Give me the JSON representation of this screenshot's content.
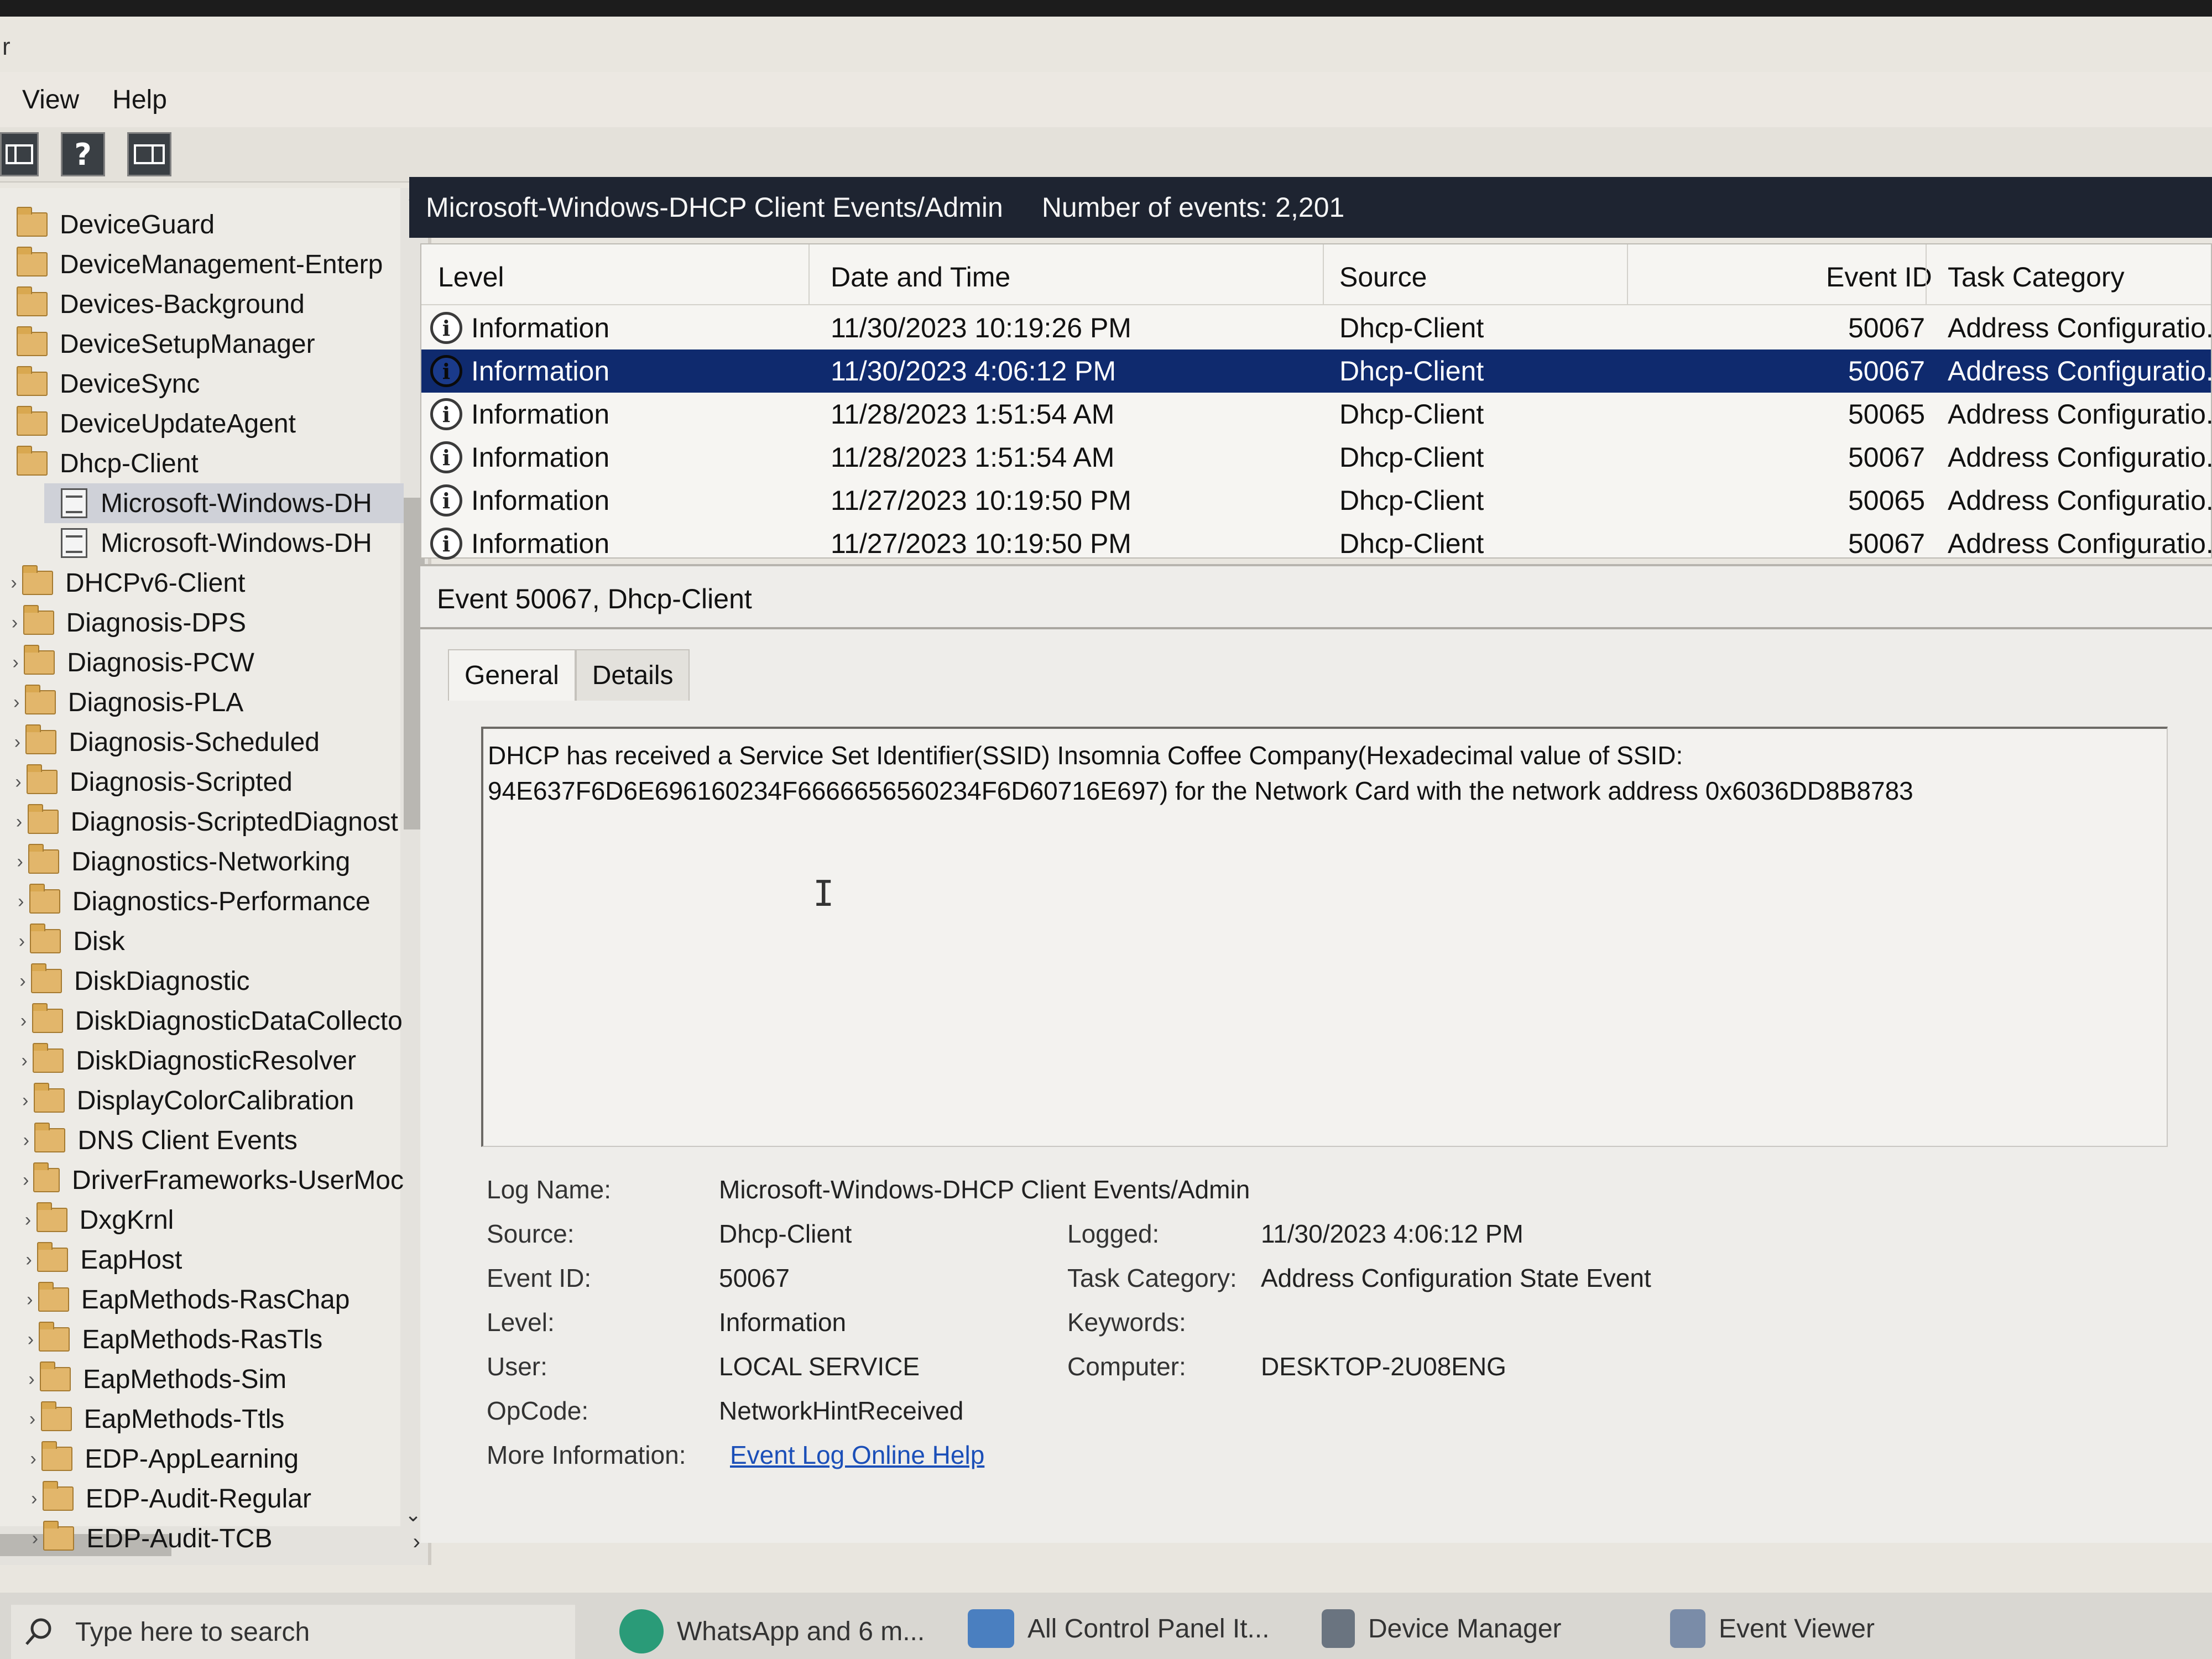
{
  "window": {
    "title_glyph": "r"
  },
  "menu": {
    "items": [
      "View",
      "Help"
    ]
  },
  "toolbar": {
    "help_glyph": "?"
  },
  "tree": {
    "items": [
      {
        "label": "DeviceGuard",
        "type": "folder",
        "selected": false
      },
      {
        "label": "DeviceManagement-Enterp",
        "type": "folder",
        "selected": false
      },
      {
        "label": "Devices-Background",
        "type": "folder",
        "selected": false
      },
      {
        "label": "DeviceSetupManager",
        "type": "folder",
        "selected": false
      },
      {
        "label": "DeviceSync",
        "type": "folder",
        "selected": false
      },
      {
        "label": "DeviceUpdateAgent",
        "type": "folder",
        "selected": false
      },
      {
        "label": "Dhcp-Client",
        "type": "folder",
        "selected": false
      },
      {
        "label": "Microsoft-Windows-DH",
        "type": "log",
        "selected": true
      },
      {
        "label": "Microsoft-Windows-DH",
        "type": "log",
        "selected": false
      },
      {
        "label": "DHCPv6-Client",
        "type": "folder",
        "selected": false
      },
      {
        "label": "Diagnosis-DPS",
        "type": "folder",
        "selected": false
      },
      {
        "label": "Diagnosis-PCW",
        "type": "folder",
        "selected": false
      },
      {
        "label": "Diagnosis-PLA",
        "type": "folder",
        "selected": false
      },
      {
        "label": "Diagnosis-Scheduled",
        "type": "folder",
        "selected": false
      },
      {
        "label": "Diagnosis-Scripted",
        "type": "folder",
        "selected": false
      },
      {
        "label": "Diagnosis-ScriptedDiagnost",
        "type": "folder",
        "selected": false
      },
      {
        "label": "Diagnostics-Networking",
        "type": "folder",
        "selected": false
      },
      {
        "label": "Diagnostics-Performance",
        "type": "folder",
        "selected": false
      },
      {
        "label": "Disk",
        "type": "folder",
        "selected": false
      },
      {
        "label": "DiskDiagnostic",
        "type": "folder",
        "selected": false
      },
      {
        "label": "DiskDiagnosticDataCollecto",
        "type": "folder",
        "selected": false
      },
      {
        "label": "DiskDiagnosticResolver",
        "type": "folder",
        "selected": false
      },
      {
        "label": "DisplayColorCalibration",
        "type": "folder",
        "selected": false
      },
      {
        "label": "DNS Client Events",
        "type": "folder",
        "selected": false
      },
      {
        "label": "DriverFrameworks-UserMoc",
        "type": "folder",
        "selected": false
      },
      {
        "label": "DxgKrnl",
        "type": "folder",
        "selected": false
      },
      {
        "label": "EapHost",
        "type": "folder",
        "selected": false
      },
      {
        "label": "EapMethods-RasChap",
        "type": "folder",
        "selected": false
      },
      {
        "label": "EapMethods-RasTls",
        "type": "folder",
        "selected": false
      },
      {
        "label": "EapMethods-Sim",
        "type": "folder",
        "selected": false
      },
      {
        "label": "EapMethods-Ttls",
        "type": "folder",
        "selected": false
      },
      {
        "label": "EDP-AppLearning",
        "type": "folder",
        "selected": false
      },
      {
        "label": "EDP-Audit-Regular",
        "type": "folder",
        "selected": false
      },
      {
        "label": "EDP-Audit-TCB",
        "type": "folder",
        "selected": false
      }
    ]
  },
  "header": {
    "log_title": "Microsoft-Windows-DHCP Client Events/Admin",
    "event_count": "Number of events: 2,201"
  },
  "grid": {
    "columns": [
      "Level",
      "Date and Time",
      "Source",
      "Event ID",
      "Task Category"
    ],
    "rows": [
      {
        "level": "Information",
        "datetime": "11/30/2023 10:19:26 PM",
        "source": "Dhcp-Client",
        "event_id": "50067",
        "category": "Address Configuratio...",
        "selected": false
      },
      {
        "level": "Information",
        "datetime": "11/30/2023 4:06:12 PM",
        "source": "Dhcp-Client",
        "event_id": "50067",
        "category": "Address Configuratio...",
        "selected": true
      },
      {
        "level": "Information",
        "datetime": "11/28/2023 1:51:54 AM",
        "source": "Dhcp-Client",
        "event_id": "50065",
        "category": "Address Configuratio...",
        "selected": false
      },
      {
        "level": "Information",
        "datetime": "11/28/2023 1:51:54 AM",
        "source": "Dhcp-Client",
        "event_id": "50067",
        "category": "Address Configuratio...",
        "selected": false
      },
      {
        "level": "Information",
        "datetime": "11/27/2023 10:19:50 PM",
        "source": "Dhcp-Client",
        "event_id": "50065",
        "category": "Address Configuratio...",
        "selected": false
      },
      {
        "level": "Information",
        "datetime": "11/27/2023 10:19:50 PM",
        "source": "Dhcp-Client",
        "event_id": "50067",
        "category": "Address Configuratio...",
        "selected": false
      }
    ]
  },
  "detail": {
    "title": "Event 50067, Dhcp-Client",
    "tabs": [
      "General",
      "Details"
    ],
    "description_line1": "DHCP has received a Service Set Identifier(SSID) Insomnia Coffee Company(Hexadecimal value of SSID:",
    "description_line2": "94E637F6D6E696160234F6666656560234F6D60716E697) for the Network Card with the network address 0x6036DD8B8783",
    "labels": {
      "log_name": "Log Name:",
      "source": "Source:",
      "event_id": "Event ID:",
      "level": "Level:",
      "user": "User:",
      "opcode": "OpCode:",
      "more_info": "More Information:",
      "logged": "Logged:",
      "task_category": "Task Category:",
      "keywords": "Keywords:",
      "computer": "Computer:"
    },
    "values": {
      "log_name": "Microsoft-Windows-DHCP Client Events/Admin",
      "source": "Dhcp-Client",
      "event_id": "50067",
      "level": "Information",
      "user": "LOCAL SERVICE",
      "opcode": "NetworkHintReceived",
      "more_info_link": "Event Log Online Help",
      "logged": "11/30/2023 4:06:12 PM",
      "task_category": "Address Configuration State Event",
      "keywords": "",
      "computer": "DESKTOP-2U08ENG"
    }
  },
  "taskbar": {
    "search_placeholder": "Type here to search",
    "apps": [
      "WhatsApp and 6 m...",
      "All Control Panel It...",
      "Device Manager",
      "Event Viewer"
    ]
  },
  "colors": {
    "selection": "#0f2a6e",
    "header_bg": "#1e2431",
    "link": "#1b4fb8"
  }
}
